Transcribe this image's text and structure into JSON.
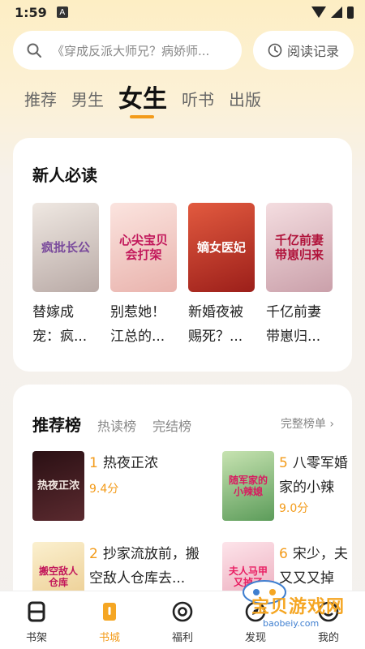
{
  "status": {
    "time": "1:59",
    "a_icon": "A"
  },
  "search": {
    "placeholder": "《穿成反派大师兄？病娇师..."
  },
  "history": {
    "label": "阅读记录"
  },
  "tabs": [
    "推荐",
    "男生",
    "女生",
    "听书",
    "出版"
  ],
  "active_tab": "女生",
  "new_reader": {
    "title": "新人必读",
    "books": [
      {
        "title_line1": "替嫁成",
        "title_line2": "宠：疯...",
        "cover_text": "疯批长公",
        "cover_color": "#d9d2cc",
        "text_color": "#7a4b9c"
      },
      {
        "title_line1": "别惹她！",
        "title_line2": "江总的...",
        "cover_text": "心尖宝贝会打架",
        "cover_color": "#f3c9c2",
        "text_color": "#c2185b"
      },
      {
        "title_line1": "新婚夜被",
        "title_line2": "赐死？...",
        "cover_text": "嫡女医妃",
        "cover_color": "#c73b2c",
        "text_color": "#ffffff"
      },
      {
        "title_line1": "千亿前妻",
        "title_line2": "带崽归...",
        "cover_text": "千亿前妻带崽归来",
        "cover_color": "#e7c9cf",
        "text_color": "#b0123a"
      }
    ]
  },
  "ranking": {
    "title": "推荐榜",
    "tabs": [
      "热读榜",
      "完结榜"
    ],
    "more": "完整榜单",
    "items": [
      {
        "num": "1",
        "line1": "热夜正浓",
        "line2": "",
        "score": "9.4分",
        "cover_text": "热夜正浓",
        "cover_color": "#3a1a1e",
        "text_color": "#f1e6e0"
      },
      {
        "num": "5",
        "line1": "八零军婚",
        "line2": "家的小辣",
        "score": "9.0分",
        "cover_text": "随军家的小辣媳",
        "cover_color": "#8fbf7a",
        "text_color": "#d81b60"
      },
      {
        "num": "2",
        "line1": "抄家流放前，搬",
        "line2": "空敌人仓库去...",
        "score": "",
        "cover_text": "搬空敌人仓库",
        "cover_color": "#f3e3b8",
        "text_color": "#c2185b"
      },
      {
        "num": "6",
        "line1": "宋少，夫",
        "line2": "又又又掉",
        "score": "",
        "cover_text": "夫人马甲又掉了",
        "cover_color": "#f7d4dc",
        "text_color": "#e91e63"
      }
    ]
  },
  "nav": [
    {
      "label": "书架",
      "icon": "bookshelf-icon"
    },
    {
      "label": "书城",
      "icon": "bookstore-icon"
    },
    {
      "label": "福利",
      "icon": "welfare-icon"
    },
    {
      "label": "发现",
      "icon": "discover-icon"
    },
    {
      "label": "我的",
      "icon": "profile-icon"
    }
  ],
  "active_nav": "书城",
  "watermark": {
    "text": "宝贝游戏网",
    "sub": "baobeiy.com"
  }
}
